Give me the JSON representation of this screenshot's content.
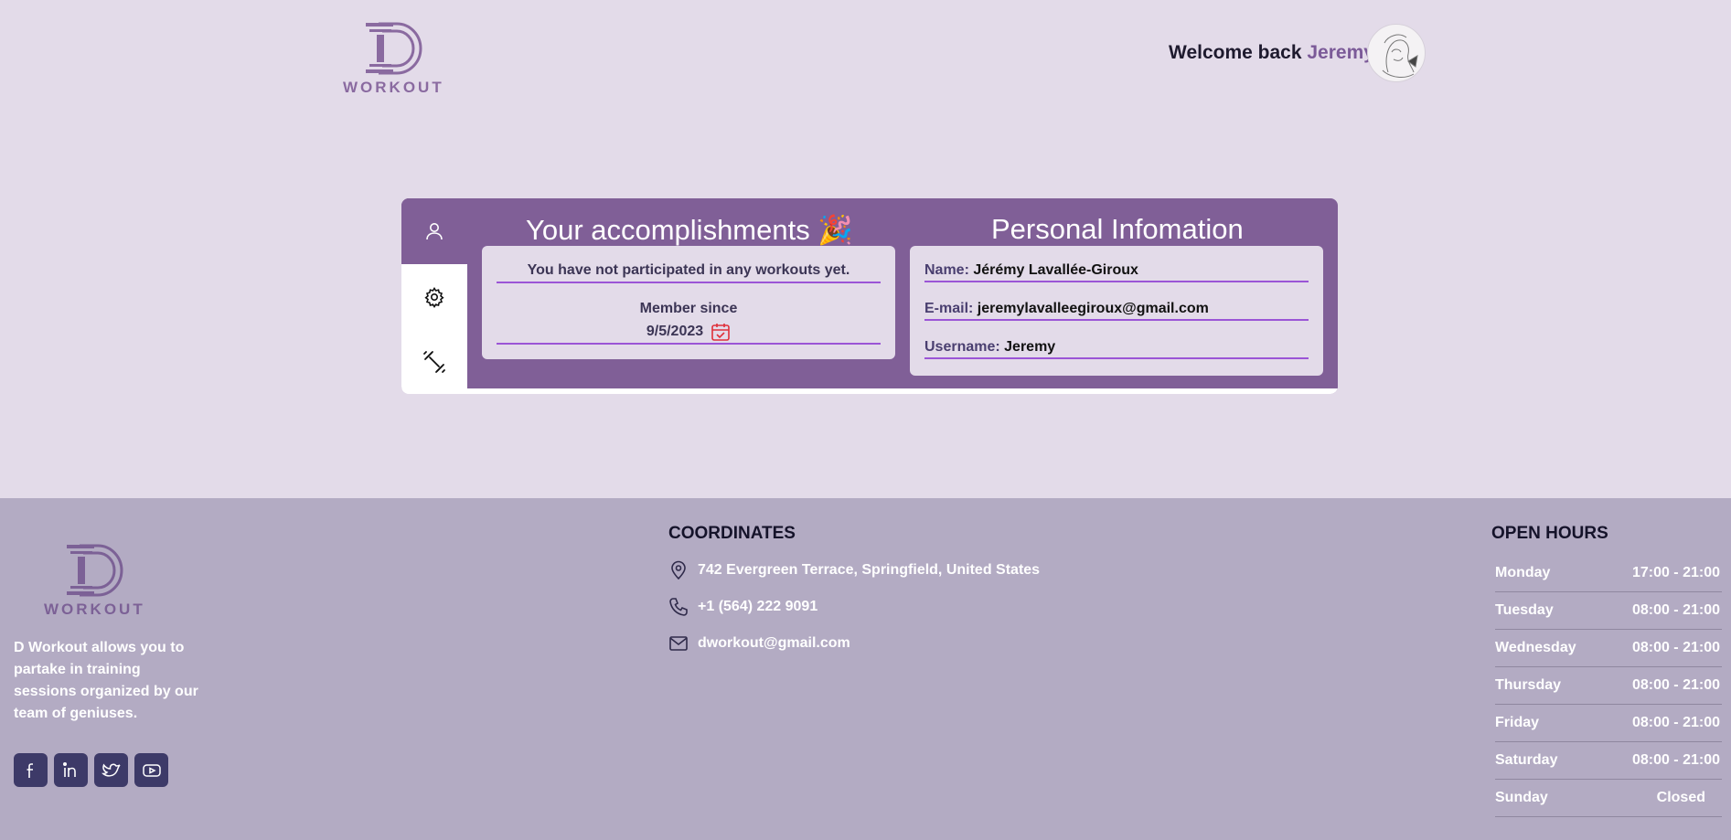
{
  "header": {
    "logo_text": "WORKOUT",
    "welcome_prefix": "Welcome back",
    "user_first_name": "Jeremy"
  },
  "profile": {
    "tabs": [
      {
        "icon": "user-icon"
      },
      {
        "icon": "gear-icon"
      },
      {
        "icon": "dumbbell-icon"
      }
    ],
    "accomplishments": {
      "title": "Your accomplishments",
      "title_emoji": "🎉",
      "no_workouts": "You have not participated in any workouts yet.",
      "member_since_label": "Member since",
      "member_since_date": "9/5/2023"
    },
    "personal": {
      "title": "Personal Infomation",
      "name_label": "Name:",
      "name_value": "Jérémy Lavallée-Giroux",
      "email_label": "E-mail:",
      "email_value": "jeremylavalleegiroux@gmail.com",
      "username_label": "Username:",
      "username_value": "Jeremy"
    }
  },
  "footer": {
    "logo_text": "WORKOUT",
    "description": "D Workout allows you to partake in training sessions organized by our team of geniuses.",
    "social": [
      "facebook-icon",
      "linkedin-icon",
      "twitter-icon",
      "youtube-icon"
    ],
    "coordinates": {
      "title": "COORDINATES",
      "address": "742 Evergreen Terrace, Springfield, United States",
      "phone": "+1 (564) 222 9091",
      "email": "dworkout@gmail.com"
    },
    "open_hours": {
      "title": "OPEN HOURS",
      "days": [
        {
          "day": "Monday",
          "time": "17:00 - 21:00"
        },
        {
          "day": "Tuesday",
          "time": "08:00 - 21:00"
        },
        {
          "day": "Wednesday",
          "time": "08:00 - 21:00"
        },
        {
          "day": "Thursday",
          "time": "08:00 - 21:00"
        },
        {
          "day": "Friday",
          "time": "08:00 - 21:00"
        },
        {
          "day": "Saturday",
          "time": "08:00 - 21:00"
        },
        {
          "day": "Sunday",
          "time": "Closed"
        }
      ]
    }
  },
  "colors": {
    "page_bg": "#e3dbe9",
    "card_purple": "#805f97",
    "accent_line": "#9b55d6",
    "footer_bg": "#b3abc3",
    "social_bg": "#3d3a68",
    "calendar_red": "#e0303a"
  }
}
